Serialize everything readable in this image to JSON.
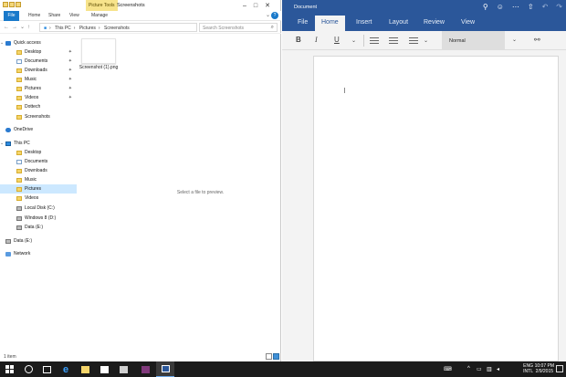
{
  "explorer": {
    "tools_tab": "Picture Tools",
    "title": "Screenshots",
    "ribbon": {
      "file": "File",
      "tabs": [
        "Home",
        "Share",
        "View",
        "Manage"
      ]
    },
    "address": {
      "segments": [
        "This PC",
        "Pictures",
        "Screenshots"
      ],
      "search_placeholder": "Search Screenshots"
    },
    "nav": {
      "quick_access": "Quick access",
      "quick_items": [
        "Desktop",
        "Documents",
        "Downloads",
        "Music",
        "Pictures",
        "Videos",
        "Dottech",
        "Screenshots"
      ],
      "onedrive": "OneDrive",
      "this_pc": "This PC",
      "pc_items": [
        "Desktop",
        "Documents",
        "Downloads",
        "Music",
        "Pictures",
        "Videos",
        "Local Disk (C:)",
        "Windows 8 (D:)",
        "Data (E:)"
      ],
      "data_drive": "Data (E:)",
      "network": "Network"
    },
    "file": {
      "name": "Screenshot (1).png"
    },
    "preview_text": "Select a file to preview.",
    "status": "1 item"
  },
  "word": {
    "title": "Document",
    "tabs": [
      "File",
      "Home",
      "Insert",
      "Layout",
      "Review",
      "View"
    ],
    "style": "Normal",
    "buttons": {
      "bold": "B",
      "italic": "I",
      "underline": "U"
    }
  },
  "taskbar": {
    "lang_top": "ENG",
    "lang_bottom": "INTL",
    "time": "10:07 PM",
    "date": "2/9/2015"
  }
}
